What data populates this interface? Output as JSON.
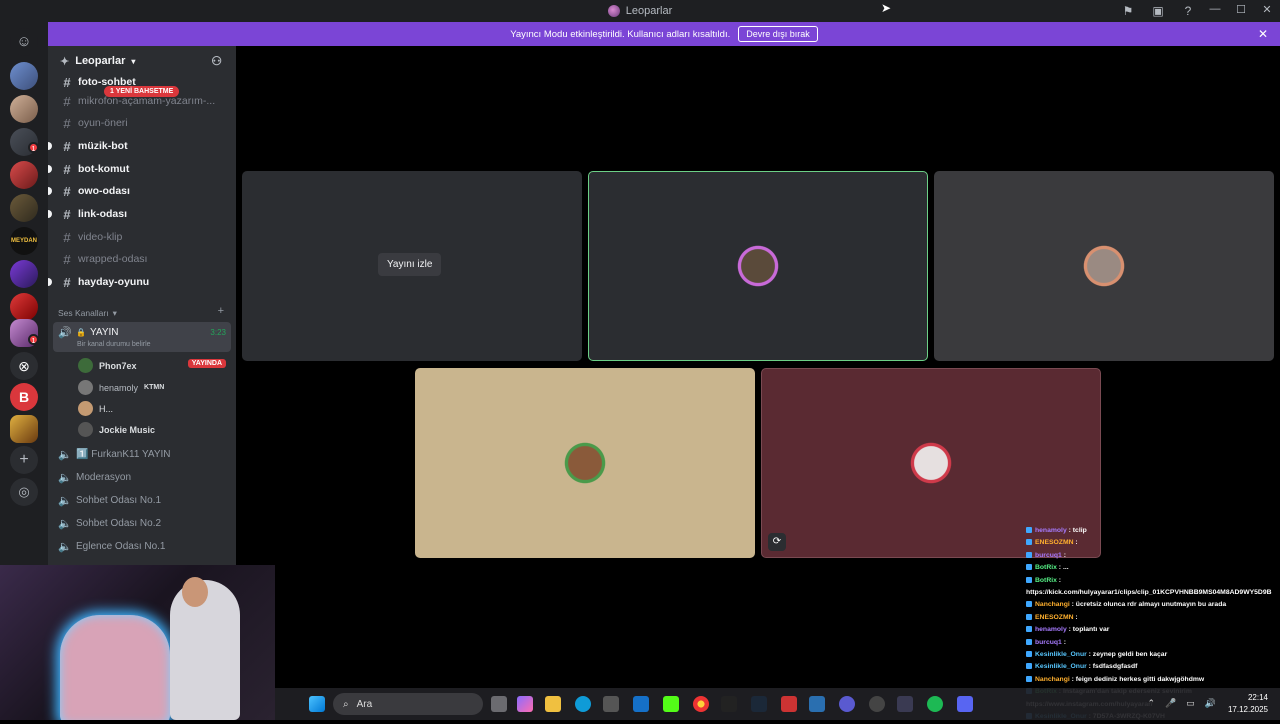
{
  "window": {
    "title": "Leoparlar"
  },
  "notice": {
    "text": "Yayıncı Modu etkinleştirildi. Kullanıcı adları kısaltıldı.",
    "button": "Devre dışı bırak"
  },
  "server": {
    "name": "Leoparlar"
  },
  "mention_pill": "1 YENİ BAHSETME",
  "text_channels": [
    {
      "name": "foto-sohbet",
      "bold": true
    },
    {
      "name": "mikrofon-açamam-yazarım-...",
      "bold": false
    },
    {
      "name": "oyun-öneri",
      "bold": false
    },
    {
      "name": "müzik-bot",
      "bold": true
    },
    {
      "name": "bot-komut",
      "bold": true
    },
    {
      "name": "owo-odası",
      "bold": true
    },
    {
      "name": "link-odası",
      "bold": true
    },
    {
      "name": "video-klip",
      "bold": false
    },
    {
      "name": "wrapped-odası",
      "bold": false
    },
    {
      "name": "hayday-oyunu",
      "bold": true
    }
  ],
  "voice_category": "Ses Kanalları",
  "active_voice": {
    "name": "YAYIN",
    "time": "3:23",
    "status": "Bir kanal durumu belirle"
  },
  "members": [
    {
      "name": "Phon7ex",
      "badge": "YAYINDA"
    },
    {
      "name": "henamoly",
      "tag": "KTMN"
    },
    {
      "name": "H..."
    },
    {
      "name": "Jockie Music"
    }
  ],
  "voice_channels": [
    "1️⃣ FurkanK11 YAYIN",
    "Moderasyon",
    "Sohbet Odası No.1",
    "Sohbet Odası No.2",
    "Eglence Odası No.1"
  ],
  "stage": {
    "watch_label": "Yayını izle"
  },
  "chat": [
    {
      "user": "henamoly",
      "color": "#a77bff",
      "msg": "tclip"
    },
    {
      "user": "ENESOZMN",
      "color": "#ffb02e",
      "msg": ""
    },
    {
      "user": "burcuq1",
      "color": "#a77bff",
      "msg": ""
    },
    {
      "user": "BotRix",
      "color": "#57f287",
      "msg": "..."
    },
    {
      "user": "BotRix",
      "color": "#57f287",
      "msg": ""
    },
    {
      "user": "",
      "color": "#fff",
      "msg": "https://kick.com/hulyayarar1/clips/clip_01KCPVHNBB9MS04M8AD9WY5D9B"
    },
    {
      "user": "Nanchangi",
      "color": "#ffb02e",
      "msg": "ücretsiz olunca rdr almayı unutmayın bu arada"
    },
    {
      "user": "ENESOZMN",
      "color": "#ffb02e",
      "msg": ""
    },
    {
      "user": "henamoly",
      "color": "#a77bff",
      "msg": "toplantı var"
    },
    {
      "user": "burcuq1",
      "color": "#a77bff",
      "msg": ""
    },
    {
      "user": "Kesinlikle_Onur",
      "color": "#57c7ff",
      "msg": "zeynep geldi ben kaçar"
    },
    {
      "user": "Kesinlikle_Onur",
      "color": "#57c7ff",
      "msg": "fsdfasdgfasdf"
    },
    {
      "user": "Nanchangi",
      "color": "#ffb02e",
      "msg": "feign dediniz herkes gitti dakwjgöhdmw"
    },
    {
      "user": "BotRix",
      "color": "#57f287",
      "msg": "Instagram'dan takip ederseniz sevinirim"
    },
    {
      "user": "",
      "color": "#fff",
      "msg": "https://www.instagram.com/hulyayarar/"
    },
    {
      "user": "Kesinlikle_Onur",
      "color": "#57c7ff",
      "msg": "7D57A-3WRZQ-K07VH"
    }
  ],
  "taskbar": {
    "search_placeholder": "Ara",
    "time": "22:14",
    "date": "17.12.2025"
  }
}
